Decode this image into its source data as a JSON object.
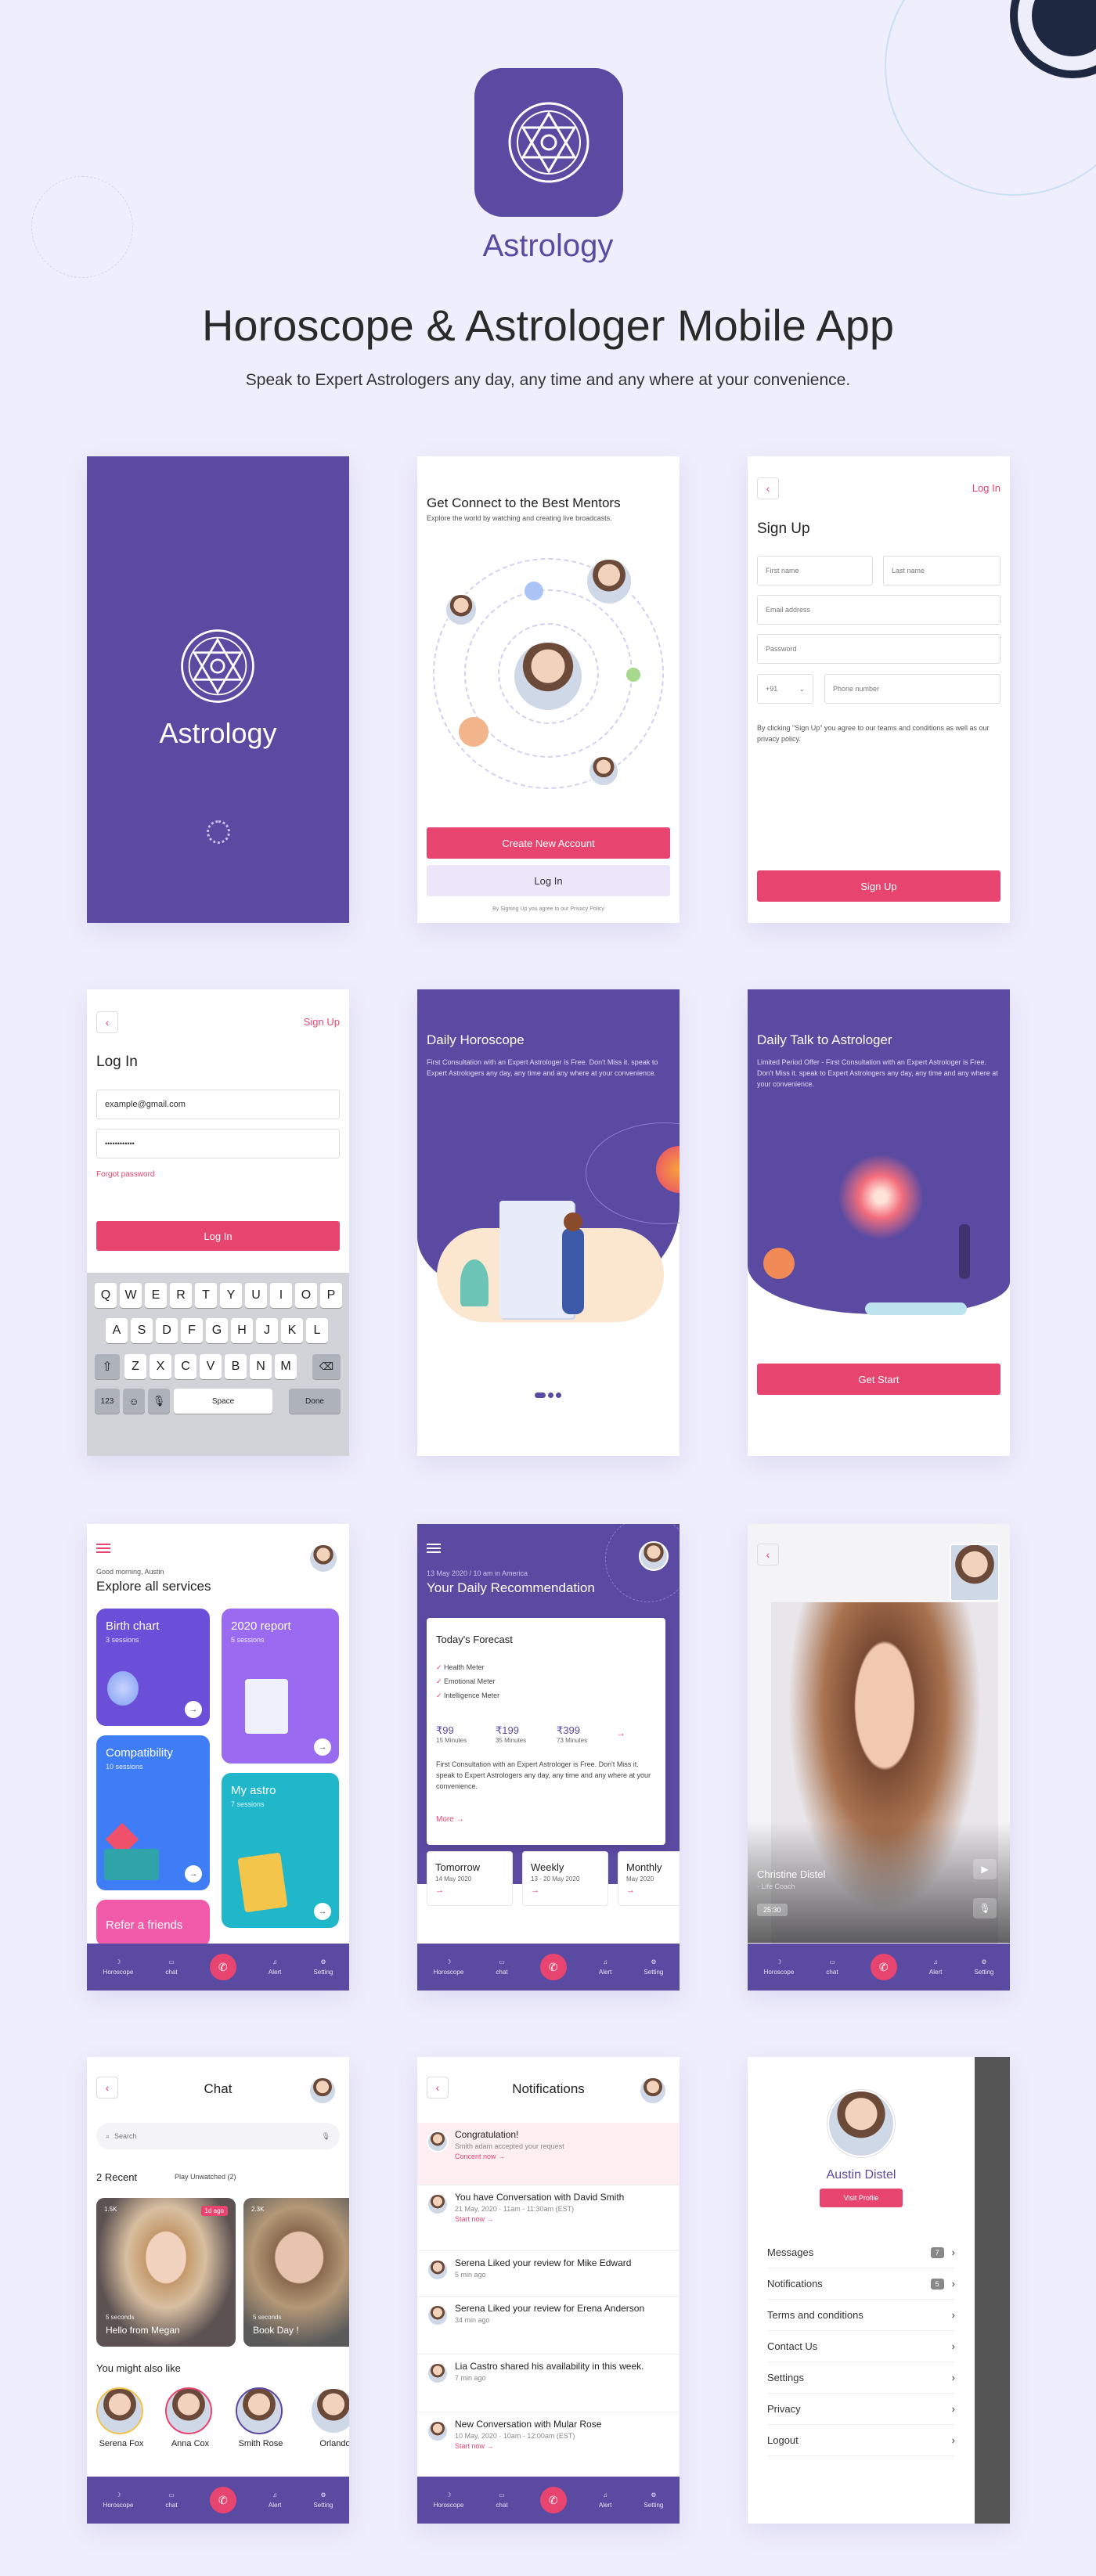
{
  "header": {
    "brand": "Astrology",
    "title": "Horoscope & Astrologer Mobile App",
    "subtitle": "Speak to Expert Astrologers any day, any time and any where at your convenience."
  },
  "colors": {
    "primary": "#5a4aa2",
    "accent": "#e7456f",
    "background": "#efeefc"
  },
  "splash": {
    "brand": "Astrology"
  },
  "mentors": {
    "title": "Get Connect to the Best Mentors",
    "subtitle": "Explore the world by watching and creating live broadcasts.",
    "create_btn": "Create New Account",
    "login_btn": "Log In",
    "footer": "By Signing Up you agree to our Privacy Policy"
  },
  "signup": {
    "back": "‹",
    "login_link": "Log In",
    "title": "Sign Up",
    "first_name": "First name",
    "last_name": "Last name",
    "email": "Email address",
    "password": "Password",
    "code": "+91",
    "phone": "Phone number",
    "terms": "By clicking \"Sign Up\" you agree to our teams and conditions as well as our privacy policy.",
    "button": "Sign Up"
  },
  "login": {
    "back": "‹",
    "signup_link": "Sign Up",
    "title": "Log In",
    "email": "example@gmail.com",
    "password": "••••••••••••",
    "forgot": "Forgot password",
    "button": "Log In",
    "row1": [
      "Q",
      "W",
      "E",
      "R",
      "T",
      "Y",
      "U",
      "I",
      "O",
      "P"
    ],
    "row2": [
      "A",
      "S",
      "D",
      "F",
      "G",
      "H",
      "J",
      "K",
      "L"
    ],
    "row3": [
      "Z",
      "X",
      "C",
      "V",
      "B",
      "N",
      "M"
    ],
    "k123": "123",
    "space": "Space",
    "done": "Done"
  },
  "daily": {
    "title": "Daily Horoscope",
    "text": "First Consultation with an Expert Astrologer is Free. Don't Miss it. speak to Expert Astrologers any day, any time and any where at your convenience."
  },
  "talk": {
    "title": "Daily Talk to Astrologer",
    "text": "Limited Period Offer - First Consultation with an Expert Astrologer is Free. Don't Miss it. speak to Expert Astrologers any day, any time and any where at your convenience.",
    "button": "Get Start"
  },
  "home": {
    "greeting": "Good morning, Austin",
    "title": "Explore all services",
    "cards": [
      {
        "name": "Birth chart",
        "sub": "3 sessions",
        "color": "#6b4fd8"
      },
      {
        "name": "2020 report",
        "sub": "5 sessions",
        "color": "#9a6bf0"
      },
      {
        "name": "Compatibility",
        "sub": "10 sessions",
        "color": "#3f7df6"
      },
      {
        "name": "My astro",
        "sub": "7 sessions",
        "color": "#1fb7c9"
      },
      {
        "name": "Refer a friends",
        "sub": "",
        "color": "#f05aa8"
      }
    ]
  },
  "tabs": {
    "horoscope": "Horoscope",
    "chat": "chat",
    "alert": "Alert",
    "setting": "Setting"
  },
  "recommend": {
    "date": "13 May 2020 / 10 am in America",
    "title": "Your Daily Recommendation",
    "forecast": "Today's Forecast",
    "checks": [
      "Health Meter",
      "Emotional Meter",
      "Intelligence Meter"
    ],
    "prices": [
      {
        "p": "₹99",
        "m": "15 Minutes"
      },
      {
        "p": "₹199",
        "m": "35 Minutes"
      },
      {
        "p": "₹399",
        "m": "73 Minutes"
      }
    ],
    "text": "First Consultation with an Expert Astrologer is Free. Don't Miss it. speak to Expert Astrologers any day, any time and any where at your convenience.",
    "more": "More",
    "periods": [
      {
        "name": "Tomorrow",
        "date": "14 May 2020"
      },
      {
        "name": "Weekly",
        "date": "13 - 20 May 2020"
      },
      {
        "name": "Monthly",
        "date": "May 2020"
      }
    ]
  },
  "video": {
    "back": "‹",
    "name": "Christine Distel",
    "role": "- Life Coach",
    "time": "25:30"
  },
  "chat": {
    "back": "‹",
    "title": "Chat",
    "search": "Search",
    "recent": "2 Recent",
    "unwatched": "Play Unwatched (2)",
    "stories": [
      {
        "views": "1.5K",
        "badge": "1d ago",
        "seconds": "5 seconds",
        "text": "Hello from Megan"
      },
      {
        "views": "2.3K",
        "badge": "",
        "seconds": "5 seconds",
        "text": "Book Day !"
      }
    ],
    "also": "You might also like",
    "people": [
      "Serena Fox",
      "Anna Cox",
      "Smith Rose",
      "Orlando"
    ]
  },
  "notifications": {
    "back": "‹",
    "title": "Notifications",
    "items": [
      {
        "title": "Congratulation!",
        "time": "Smith adam accepted your request",
        "link": "Concent now"
      },
      {
        "title": "You have Conversation with David Smith",
        "time": "21 May, 2020 · 11am - 11:30am (EST)",
        "link": "Start now"
      },
      {
        "title": "Serena Liked your review for Mike Edward",
        "time": "5 min ago",
        "link": ""
      },
      {
        "title": "Serena Liked your review for Erena Anderson",
        "time": "34 min ago",
        "link": ""
      },
      {
        "title": "Lia Castro shared his availability in this week.",
        "time": "7 min ago",
        "link": ""
      },
      {
        "title": "New Conversation with Mular Rose",
        "time": "10 May, 2020 · 10am - 12:00am (EST)",
        "link": "Start now"
      }
    ]
  },
  "profile": {
    "name": "Austin Distel",
    "button": "Visit Profile",
    "menu": [
      {
        "label": "Messages",
        "badge": "7"
      },
      {
        "label": "Notifications",
        "badge": "5"
      },
      {
        "label": "Terms and conditions",
        "badge": ""
      },
      {
        "label": "Contact Us",
        "badge": ""
      },
      {
        "label": "Settings",
        "badge": ""
      },
      {
        "label": "Privacy",
        "badge": ""
      },
      {
        "label": "Logout",
        "badge": ""
      }
    ]
  }
}
